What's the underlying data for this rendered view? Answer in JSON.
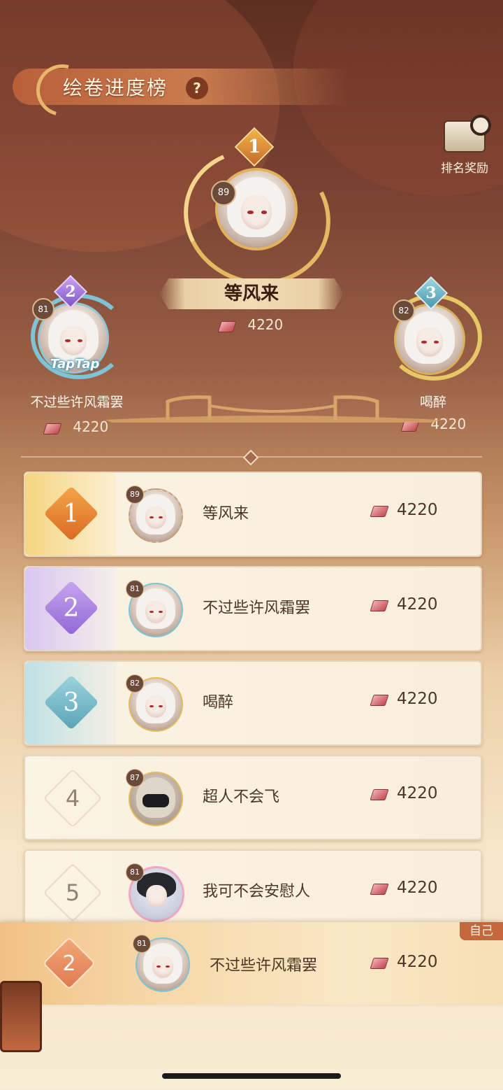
{
  "header": {
    "title": "绘卷进度榜",
    "help_label": "?"
  },
  "reward": {
    "label": "排名奖励",
    "icon": "chest-magnifier-icon"
  },
  "podium": {
    "first": {
      "rank": "1",
      "level": "89",
      "name": "等风来",
      "score": "4220"
    },
    "second": {
      "rank": "2",
      "level": "81",
      "name": "不过些许风霜罢",
      "score": "4220",
      "frame_text": "TapTap"
    },
    "third": {
      "rank": "3",
      "level": "82",
      "name": "喝醉",
      "score": "4220"
    }
  },
  "list": [
    {
      "rank": "1",
      "level": "89",
      "name": "等风来",
      "score": "4220"
    },
    {
      "rank": "2",
      "level": "81",
      "name": "不过些许风霜罢",
      "score": "4220"
    },
    {
      "rank": "3",
      "level": "82",
      "name": "喝醉",
      "score": "4220"
    },
    {
      "rank": "4",
      "level": "87",
      "name": "超人不会飞",
      "score": "4220"
    },
    {
      "rank": "5",
      "level": "81",
      "name": "我可不会安慰人",
      "score": "4220"
    }
  ],
  "self": {
    "tag": "自己",
    "rank": "2",
    "level": "81",
    "name": "不过些许风霜罢",
    "score": "4220"
  },
  "colors": {
    "gold": "#e8a23c",
    "purple": "#b48be0",
    "teal": "#6fb9c8",
    "accent": "#c4673c"
  }
}
